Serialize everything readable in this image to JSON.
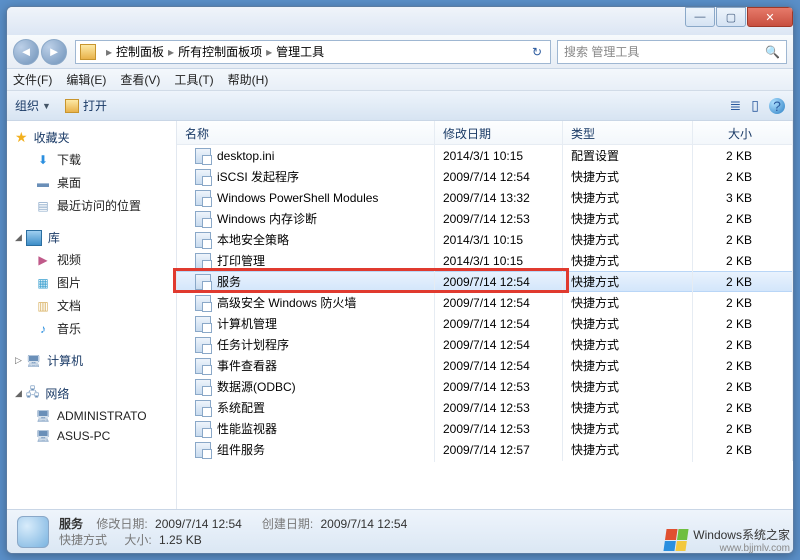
{
  "titlebar": {
    "min": "—",
    "max": "▢",
    "close": "✕"
  },
  "nav": {
    "back": "◄",
    "fwd": "►",
    "crumbs": [
      "控制面板",
      "所有控制面板项",
      "管理工具"
    ],
    "sep": "▸",
    "refresh": "↻",
    "search_placeholder": "搜索 管理工具",
    "search_icon": "🔍"
  },
  "menubar": [
    "文件(F)",
    "编辑(E)",
    "查看(V)",
    "工具(T)",
    "帮助(H)"
  ],
  "toolbar": {
    "organize": "组织",
    "open": "打开",
    "drop": "▼",
    "view_icon": "≣",
    "help": "?"
  },
  "sidebar": {
    "fav_star": "★",
    "fav_label": "收藏夹",
    "favs": [
      {
        "icon": "⬇",
        "label": "下载",
        "color": "#2b8fdf"
      },
      {
        "icon": "▬",
        "label": "桌面",
        "color": "#6a8fb8"
      },
      {
        "icon": "▤",
        "label": "最近访问的位置",
        "color": "#8aa8c8"
      }
    ],
    "tri_open": "◢",
    "tri_closed": "▷",
    "lib_label": "库",
    "libs": [
      {
        "icon": "▶",
        "label": "视频",
        "color": "#c05a8a"
      },
      {
        "icon": "▦",
        "label": "图片",
        "color": "#3aa0d0"
      },
      {
        "icon": "▥",
        "label": "文档",
        "color": "#d8b060"
      },
      {
        "icon": "♪",
        "label": "音乐",
        "color": "#2b8fdf"
      }
    ],
    "computer_label": "计算机",
    "network_label": "网络",
    "nets": [
      {
        "icon": "🖥",
        "label": "ADMINISTRATO"
      },
      {
        "icon": "🖥",
        "label": "ASUS-PC"
      }
    ]
  },
  "columns": {
    "name": "名称",
    "date": "修改日期",
    "type": "类型",
    "size": "大小"
  },
  "rows": [
    {
      "name": "desktop.ini",
      "date": "2014/3/1 10:15",
      "type": "配置设置",
      "size": "2 KB"
    },
    {
      "name": "iSCSI 发起程序",
      "date": "2009/7/14 12:54",
      "type": "快捷方式",
      "size": "2 KB"
    },
    {
      "name": "Windows PowerShell Modules",
      "date": "2009/7/14 13:32",
      "type": "快捷方式",
      "size": "3 KB"
    },
    {
      "name": "Windows 内存诊断",
      "date": "2009/7/14 12:53",
      "type": "快捷方式",
      "size": "2 KB"
    },
    {
      "name": "本地安全策略",
      "date": "2014/3/1 10:15",
      "type": "快捷方式",
      "size": "2 KB"
    },
    {
      "name": "打印管理",
      "date": "2014/3/1 10:15",
      "type": "快捷方式",
      "size": "2 KB"
    },
    {
      "name": "服务",
      "date": "2009/7/14 12:54",
      "type": "快捷方式",
      "size": "2 KB",
      "selected": true
    },
    {
      "name": "高级安全 Windows 防火墙",
      "date": "2009/7/14 12:54",
      "type": "快捷方式",
      "size": "2 KB"
    },
    {
      "name": "计算机管理",
      "date": "2009/7/14 12:54",
      "type": "快捷方式",
      "size": "2 KB"
    },
    {
      "name": "任务计划程序",
      "date": "2009/7/14 12:54",
      "type": "快捷方式",
      "size": "2 KB"
    },
    {
      "name": "事件查看器",
      "date": "2009/7/14 12:54",
      "type": "快捷方式",
      "size": "2 KB"
    },
    {
      "name": "数据源(ODBC)",
      "date": "2009/7/14 12:53",
      "type": "快捷方式",
      "size": "2 KB"
    },
    {
      "name": "系统配置",
      "date": "2009/7/14 12:53",
      "type": "快捷方式",
      "size": "2 KB"
    },
    {
      "name": "性能监视器",
      "date": "2009/7/14 12:53",
      "type": "快捷方式",
      "size": "2 KB"
    },
    {
      "name": "组件服务",
      "date": "2009/7/14 12:57",
      "type": "快捷方式",
      "size": "2 KB"
    }
  ],
  "status": {
    "title": "服务",
    "mod_label": "修改日期:",
    "mod_val": "2009/7/14 12:54",
    "create_label": "创建日期:",
    "create_val": "2009/7/14 12:54",
    "type_label": "快捷方式",
    "size_label": "大小:",
    "size_val": "1.25 KB"
  },
  "watermark": {
    "brand": "Windows",
    "suffix": "系统之家",
    "url": "www.bjjmlv.com"
  },
  "highlight_row_index": 6
}
